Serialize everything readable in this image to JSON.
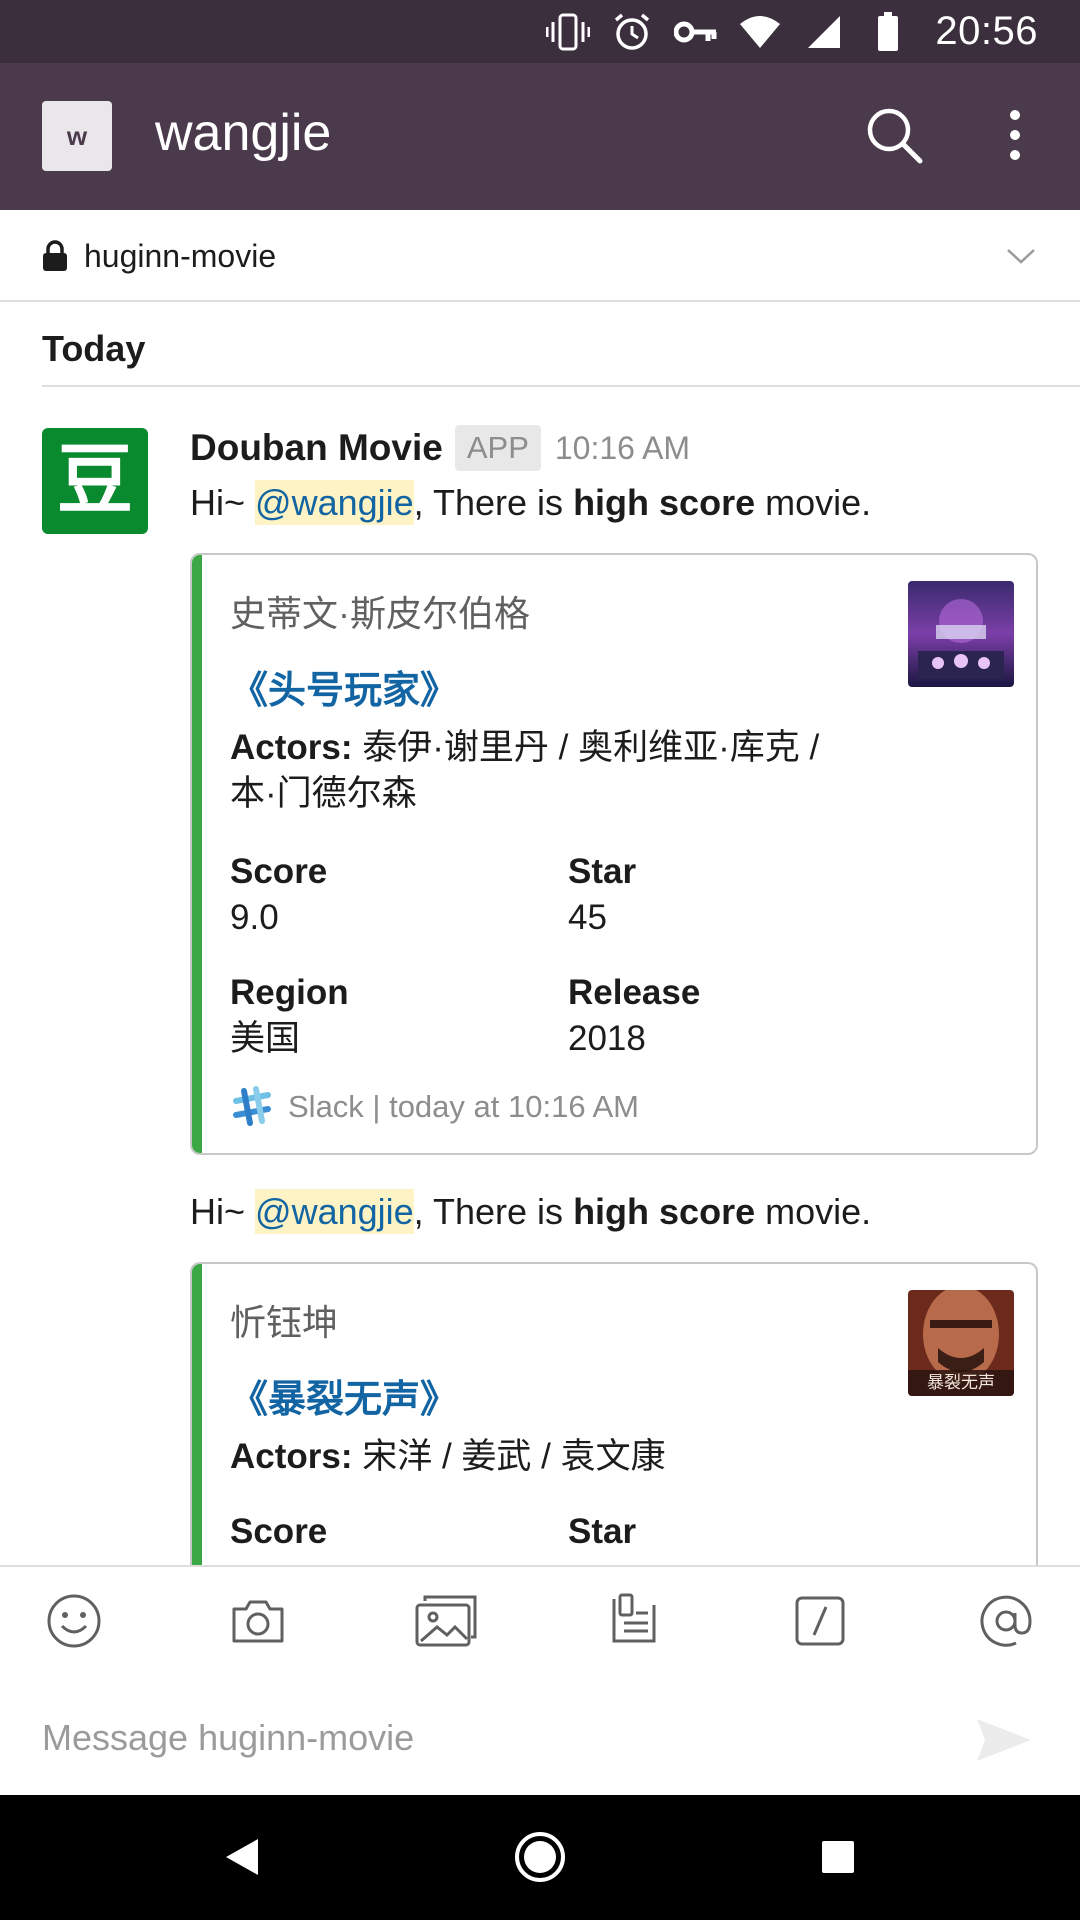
{
  "status_bar": {
    "time": "20:56"
  },
  "app_bar": {
    "workspace_initial": "w",
    "workspace_name": "wangjie"
  },
  "channel": {
    "name": "huginn-movie"
  },
  "day_divider": "Today",
  "message": {
    "sender": "Douban Movie",
    "badge": "APP",
    "time": "10:16 AM",
    "avatar_glyph": "豆",
    "avatar_color": "#0a8a2e"
  },
  "posts": [
    {
      "greeting": "Hi~ ",
      "mention": "@wangjie",
      "text_a": ", There is ",
      "text_bold": "high score",
      "text_b": " movie.",
      "card": {
        "author": "史蒂文·斯皮尔伯格",
        "title": "《头号玩家》",
        "actors_label": "Actors:",
        "actors_line1": " 泰伊·谢里丹 / 奥利维亚·库克 /",
        "actors_line2": "本·门德尔森",
        "score_label": "Score",
        "score": "9.0",
        "star_label": "Star",
        "star": "45",
        "region_label": "Region",
        "region": "美国",
        "release_label": "Release",
        "release": "2018",
        "footer": "Slack | today at 10:16 AM"
      }
    },
    {
      "greeting": "Hi~ ",
      "mention": "@wangjie",
      "text_a": ", There is ",
      "text_bold": "high score",
      "text_b": " movie.",
      "card": {
        "author": "忻钰坤",
        "title": "《暴裂无声》",
        "actors_label": "Actors:",
        "actors_line1": " 宋洋 / 姜武 / 袁文康",
        "score_label": "Score",
        "star_label": "Star",
        "poster_text": "暴裂无声"
      }
    }
  ],
  "composer": {
    "placeholder": "Message huginn-movie"
  },
  "colors": {
    "status_bar": "#3b2e3d",
    "app_bar": "#4a3a4c",
    "accent_bar": "#3ba745",
    "link": "#1264a3",
    "mention_bg": "#fdf3c4"
  },
  "icons": [
    "vibrate-icon",
    "alarm-icon",
    "key-icon",
    "wifi-icon",
    "signal-icon",
    "battery-icon",
    "search-icon",
    "more-vert-icon",
    "lock-icon",
    "chevron-down-icon",
    "emoji-icon",
    "camera-icon",
    "gallery-icon",
    "files-icon",
    "slash-command-icon",
    "at-mention-icon",
    "send-icon",
    "back-icon",
    "home-icon",
    "recents-icon"
  ]
}
